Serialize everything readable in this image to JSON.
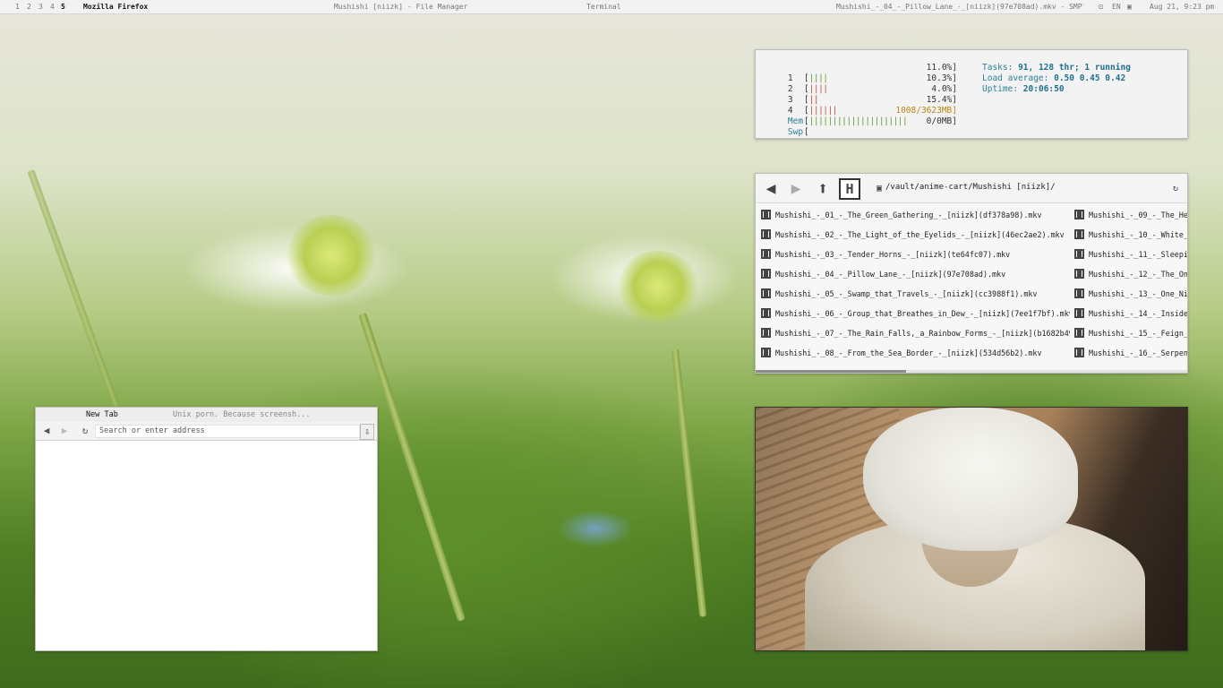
{
  "topbar": {
    "workspaces": [
      "1",
      "2",
      "3",
      "4",
      "5"
    ],
    "active_app": "Mozilla Firefox",
    "window_titles": [
      "Mushishi [niizk] - File Manager",
      "Terminal",
      "Mushishi_-_04_-_Pillow_Lane_-_[niizk](97e708ad).mkv - SMPla..."
    ],
    "lang": "EN",
    "datetime": "Aug 21, 9:23 pm"
  },
  "htop": {
    "cpus": [
      {
        "label": "1",
        "bar": "||||",
        "pct": "11.0%]"
      },
      {
        "label": "2",
        "bar": "||||",
        "pct": "10.3%]"
      },
      {
        "label": "3",
        "bar": "||",
        "pct": "4.0%]"
      },
      {
        "label": "4",
        "bar": "||||||",
        "pct": "15.4%]"
      }
    ],
    "mem": {
      "label": "Mem",
      "bar": "|||||||||||||||||||||",
      "value": "1008/3623MB]"
    },
    "swp": {
      "label": "Swp",
      "value": "0/0MB]"
    },
    "tasks_label": "Tasks:",
    "tasks": "91, 128 thr; 1 running",
    "load_label": "Load average:",
    "load": "0.50 0.45 0.42",
    "uptime_label": "Uptime:",
    "uptime": "20:06:50"
  },
  "file_manager": {
    "path": "/vault/anime-cart/Mushishi [niizk]/",
    "files_col1": [
      "Mushishi_-_01_-_The_Green_Gathering_-_[niizk](df378a98).mkv",
      "Mushishi_-_02_-_The_Light_of_the_Eyelids_-_[niizk](46ec2ae2).mkv",
      "Mushishi_-_03_-_Tender_Horns_-_[niizk](te64fc07).mkv",
      "Mushishi_-_04_-_Pillow_Lane_-_[niizk](97e708ad).mkv",
      "Mushishi_-_05_-_Swamp_that_Travels_-_[niizk](cc3988f1).mkv",
      "Mushishi_-_06_-_Group_that_Breathes_in_Dew_-_[niizk](7ee1f7bf).mkv",
      "Mushishi_-_07_-_The_Rain_Falls,_a_Rainbow_Forms_-_[niizk](b1682b49).mkv",
      "Mushishi_-_08_-_From_the_Sea_Border_-_[niizk](534d56b2).mkv"
    ],
    "files_col2": [
      "Mushishi_-_09_-_The_Hea",
      "Mushishi_-_10_-_White_in",
      "Mushishi_-_11_-_Sleeping_",
      "Mushishi_-_12_-_The_One",
      "Mushishi_-_13_-_One_Nigh",
      "Mushishi_-_14_-_Inside_t",
      "Mushishi_-_15_-_Feign_Sp",
      "Mushishi_-_16_-_Serpent"
    ]
  },
  "firefox": {
    "tab_active": "New Tab",
    "tab_other": "Unix porn. Because screensh...",
    "url_placeholder": "Search or enter address"
  }
}
